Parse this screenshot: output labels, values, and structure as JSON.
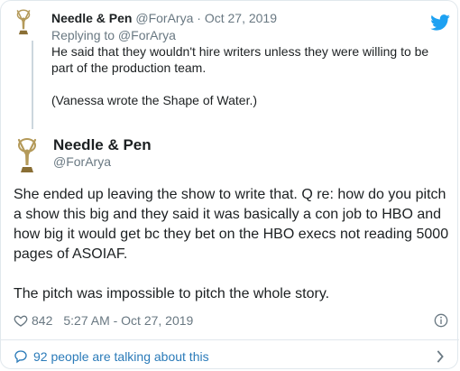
{
  "parent_tweet": {
    "author_name": "Needle & Pen",
    "author_handle": "@ForArya",
    "separator": "·",
    "date": "Oct 27, 2019",
    "replying_to": "Replying to @ForArya",
    "paragraphs": [
      "He said that they wouldn't hire writers unless they were willing to be part of the production team.",
      "(Vanessa wrote the Shape of Water.)"
    ]
  },
  "main_tweet": {
    "author_name": "Needle & Pen",
    "author_handle": "@ForArya",
    "paragraphs": [
      "She ended up leaving the show to write that. Q re: how do you pitch a show this big and they said it was basically a con job to HBO and how big it would get bc they bet on the HBO execs not reading 5000 pages of ASOIAF.",
      "The pitch was impossible to pitch the whole story."
    ],
    "like_count": "842",
    "timestamp": "5:27 AM - Oct 27, 2019"
  },
  "footer": {
    "talking_text": "92 people are talking about this"
  },
  "colors": {
    "link_blue": "#2b7bb9",
    "twitter_blue": "#1da1f2",
    "muted": "#697882",
    "border": "#e1e8ed",
    "emmy_gold": "#b49a5a"
  },
  "icons": {
    "avatar": "emmy-statuette",
    "brand": "twitter-bird-icon",
    "like": "heart-icon",
    "info": "info-icon",
    "conversation": "speech-bubble-icon",
    "more": "chevron-right-icon"
  }
}
